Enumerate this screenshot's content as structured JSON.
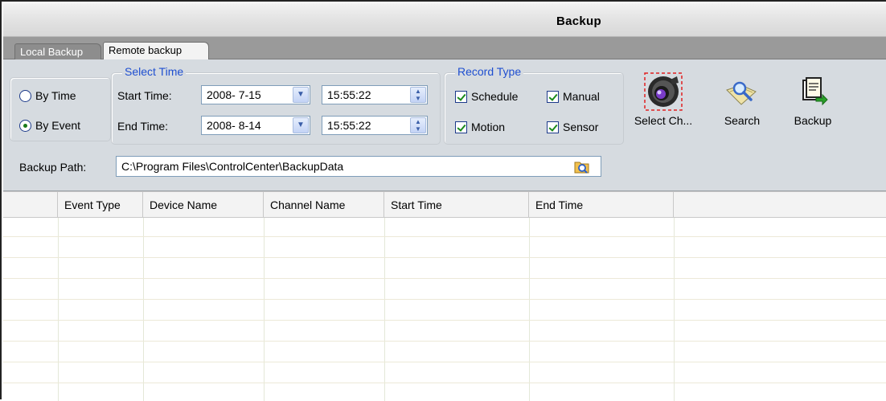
{
  "window": {
    "title": "Backup"
  },
  "tabs": [
    {
      "label": "Local Backup",
      "active": false
    },
    {
      "label": "Remote backup",
      "active": true
    }
  ],
  "mode": {
    "options": [
      {
        "label": "By Time",
        "checked": false
      },
      {
        "label": "By Event",
        "checked": true
      }
    ]
  },
  "select_time": {
    "group_title": "Select Time",
    "start_label": "Start Time:",
    "start_date": "2008- 7-15",
    "start_time": "15:55:22",
    "end_label": "End Time:",
    "end_date": "2008- 8-14",
    "end_time": "15:55:22"
  },
  "record_type": {
    "group_title": "Record Type",
    "items": [
      {
        "label": "Schedule",
        "checked": true
      },
      {
        "label": "Manual",
        "checked": true
      },
      {
        "label": "Motion",
        "checked": true
      },
      {
        "label": "Sensor",
        "checked": true
      }
    ]
  },
  "toolbar": {
    "select_channel_label": "Select Ch...",
    "search_label": "Search",
    "backup_label": "Backup"
  },
  "backup_path": {
    "label": "Backup Path:",
    "value": "C:\\Program Files\\ControlCenter\\BackupData"
  },
  "table": {
    "columns": [
      "",
      "Event Type",
      "Device Name",
      "Channel Name",
      "Start Time",
      "End Time",
      ""
    ],
    "rows": []
  },
  "colors": {
    "accent_blue": "#1f4fd0",
    "panel_bg": "#d6dbe0",
    "tabstrip_bg": "#9a9a9a"
  },
  "icons": {
    "select_channel": "camera-icon",
    "search": "search-icon",
    "backup": "backup-document-icon",
    "browse": "folder-browse-icon"
  }
}
